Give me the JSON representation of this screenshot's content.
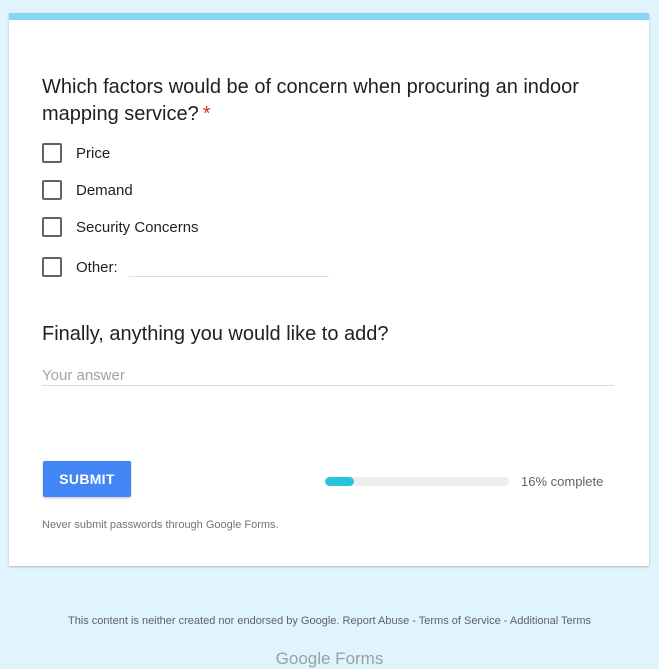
{
  "form": {
    "question1": {
      "title": "Which factors would be of concern when procuring an indoor mapping service?",
      "required_mark": "*",
      "options": [
        {
          "label": "Price",
          "checked": false
        },
        {
          "label": "Demand",
          "checked": false
        },
        {
          "label": "Security Concerns",
          "checked": false
        },
        {
          "label": "Other:",
          "checked": false
        }
      ],
      "other_value": ""
    },
    "question2": {
      "title": "Finally, anything you would like to add?",
      "placeholder": "Your answer",
      "value": ""
    },
    "submit_label": "SUBMIT",
    "progress": {
      "percent": 16,
      "text": "16% complete"
    },
    "warning": "Never submit passwords through Google Forms."
  },
  "footer": {
    "text": "This content is neither created nor endorsed by Google.",
    "links": [
      "Report Abuse",
      "Terms of Service",
      "Additional Terms"
    ],
    "separator": "-",
    "logo": "Google Forms"
  },
  "colors": {
    "background": "#e0f4fd",
    "header_bar": "#8ad5f3",
    "submit": "#4285f4",
    "progress_fill": "#26c6da",
    "required": "#d93025"
  }
}
